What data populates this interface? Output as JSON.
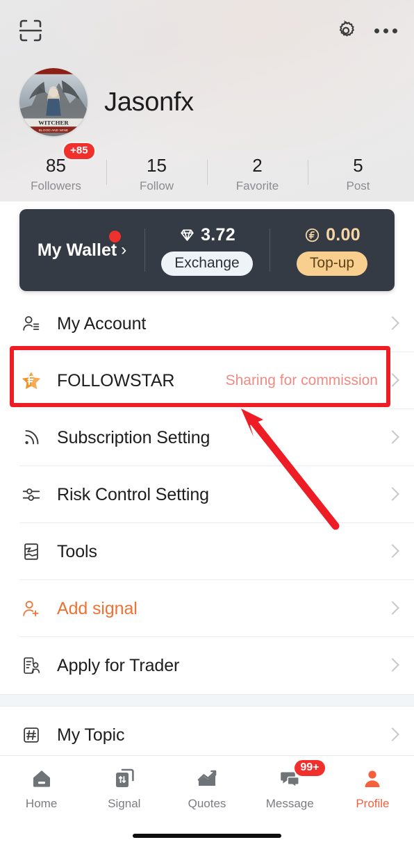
{
  "header": {
    "scan_icon": "scan-icon",
    "gear_icon": "gear-icon",
    "more_icon": "more-dots-icon",
    "username": "Jasonfx",
    "avatar_alt": "witcher-3-blood-and-wine-artwork"
  },
  "stats": [
    {
      "value": "85",
      "label": "Followers",
      "badge": "+85"
    },
    {
      "value": "15",
      "label": "Follow",
      "badge": ""
    },
    {
      "value": "2",
      "label": "Favorite",
      "badge": ""
    },
    {
      "value": "5",
      "label": "Post",
      "badge": ""
    }
  ],
  "wallet": {
    "title": "My Wallet",
    "chevron": "›",
    "has_notification_dot": true,
    "gem": {
      "icon": "diamond-icon",
      "amount": "3.72",
      "button": "Exchange"
    },
    "coin": {
      "icon": "coin-icon",
      "amount": "0.00",
      "button": "Top-up"
    }
  },
  "menu": [
    {
      "icon": "account-person-icon",
      "label": "My Account",
      "extra": "",
      "accent": false
    },
    {
      "icon": "followstar-icon",
      "label": "FOLLOWSTAR",
      "extra": "Sharing for commission",
      "accent": false
    },
    {
      "icon": "rss-signal-icon",
      "label": "Subscription Setting",
      "extra": "",
      "accent": false
    },
    {
      "icon": "sliders-icon",
      "label": "Risk Control Setting",
      "extra": "",
      "accent": false
    },
    {
      "icon": "tools-icon",
      "label": "Tools",
      "extra": "",
      "accent": false
    },
    {
      "icon": "add-person-icon",
      "label": "Add signal",
      "extra": "",
      "accent": true
    },
    {
      "icon": "trader-document-icon",
      "label": "Apply for Trader",
      "extra": "",
      "accent": false
    }
  ],
  "menu_group_2": [
    {
      "icon": "hash-icon",
      "label": "My Topic",
      "extra": "",
      "accent": false
    }
  ],
  "tabbar": [
    {
      "icon": "home-icon",
      "label": "Home",
      "badge": "",
      "active": false
    },
    {
      "icon": "signal-icon",
      "label": "Signal",
      "badge": "",
      "active": false
    },
    {
      "icon": "quotes-icon",
      "label": "Quotes",
      "badge": "",
      "active": false
    },
    {
      "icon": "message-icon",
      "label": "Message",
      "badge": "99+",
      "active": false
    },
    {
      "icon": "profile-icon",
      "label": "Profile",
      "badge": "",
      "active": true
    }
  ],
  "annotation": {
    "highlight_color": "#ee1c25",
    "arrow_color": "#ee1c25",
    "target": "FOLLOWSTAR"
  },
  "colors": {
    "accent_orange": "#ee7233",
    "badge_red": "#f0302c",
    "wallet_bg": "#343b45",
    "topup_yellow": "#f8cf8f",
    "commission_text": "#f08a83",
    "profile_active": "#f4603c"
  }
}
